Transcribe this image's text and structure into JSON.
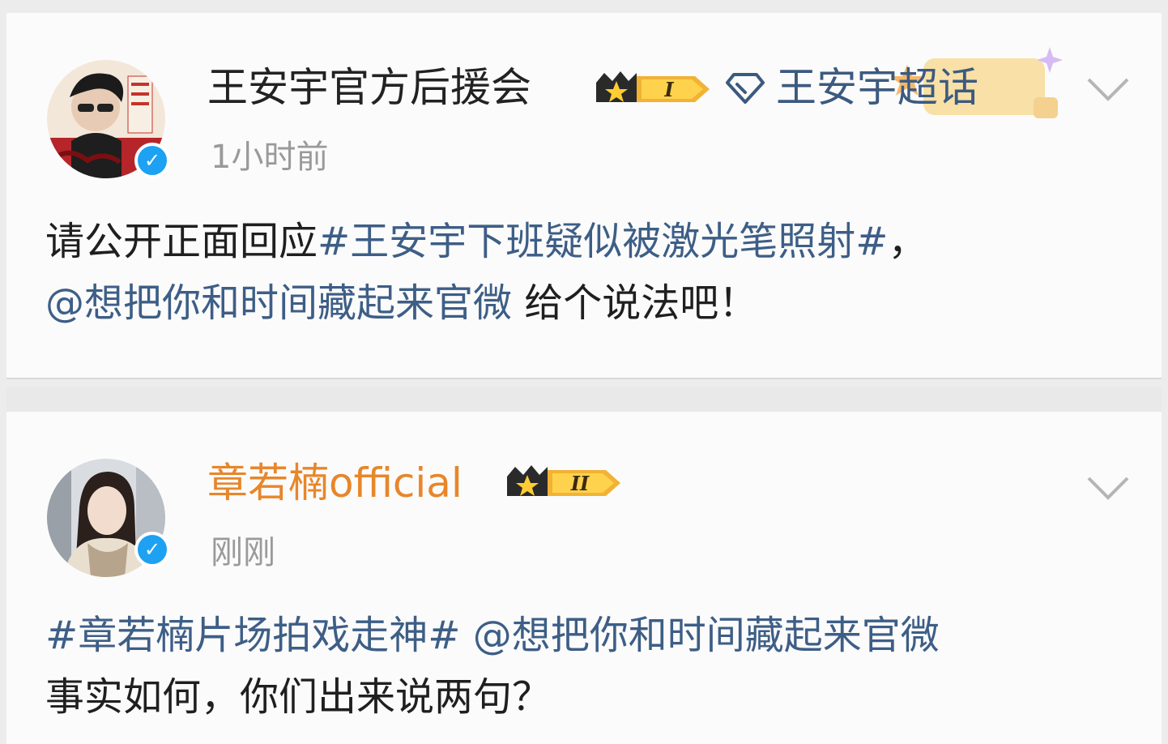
{
  "posts": [
    {
      "username": "王安宇官方后援会",
      "badge_level": "I",
      "super_topic": "王安宇超话",
      "timestamp": "1小时前",
      "body": {
        "text1": "请公开正面回应",
        "hashtag": "#王安宇下班疑似被激光笔照射#",
        "text2": "，",
        "mention": "@想把你和时间藏起来官微",
        "text3": " 给个说法吧！"
      }
    },
    {
      "username": "章若楠official",
      "badge_level": "II",
      "timestamp": "刚刚",
      "body": {
        "hashtag": "#章若楠片场拍戏走神#",
        "mention": " @想把你和时间藏起来官微",
        "text1": "事实如何，你们出来说两句？"
      }
    }
  ],
  "colors": {
    "link": "#3d5e86",
    "username_highlight": "#e8862a",
    "verified": "#1da1f2",
    "timestamp": "#9a9a9a"
  },
  "icons": {
    "verified": "verified-icon",
    "crown_badge": "crown-badge-icon",
    "super_topic": "diamond-icon",
    "more": "chevron-down-icon"
  }
}
